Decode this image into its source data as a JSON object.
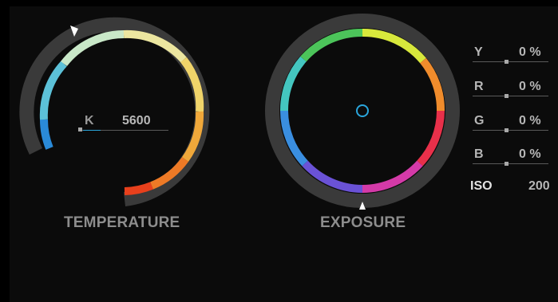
{
  "temperature": {
    "label": "TEMPERATURE",
    "unit_label": "K",
    "value": "5600"
  },
  "exposure": {
    "label": "EXPOSURE"
  },
  "channels": [
    {
      "name": "Y",
      "value": "0 %"
    },
    {
      "name": "R",
      "value": "0 %"
    },
    {
      "name": "G",
      "value": "0 %"
    },
    {
      "name": "B",
      "value": "0 %"
    }
  ],
  "iso": {
    "label": "ISO",
    "value": "200"
  },
  "colors": {
    "panel_bg": "#0b0b0b",
    "ring_track": "#3a3a3a",
    "accent": "#2aa6dc"
  }
}
